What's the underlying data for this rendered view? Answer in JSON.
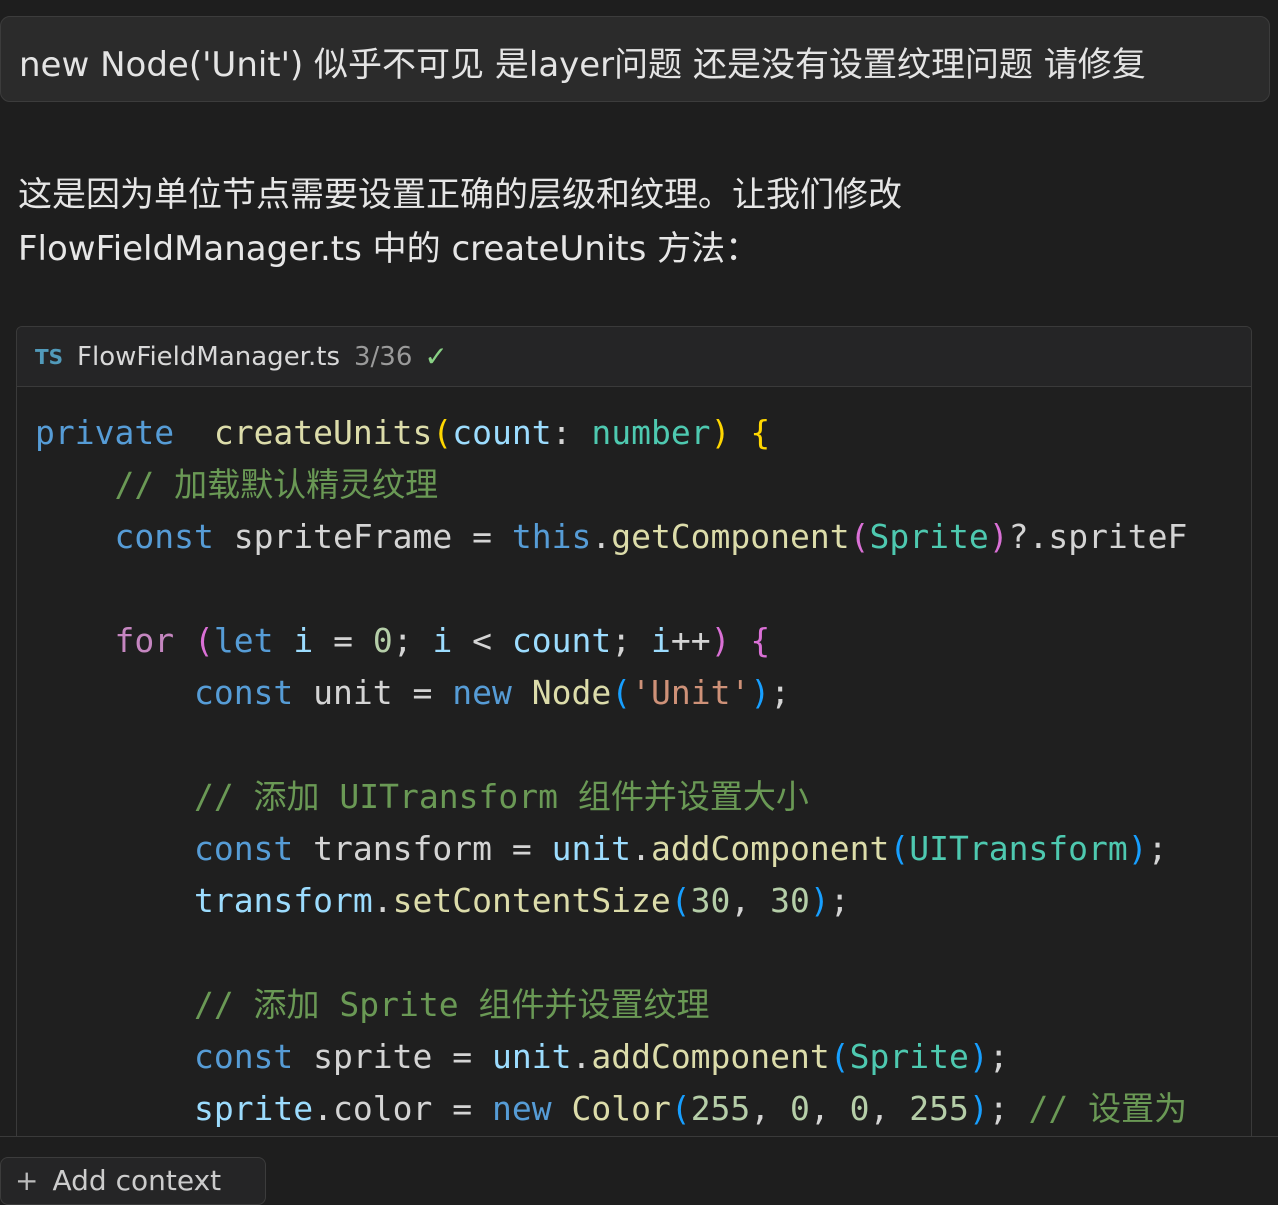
{
  "user_message": "new Node('Unit') 似乎不可见 是layer问题 还是没有设置纹理问题 请修复",
  "assistant": {
    "line1": "这是因为单位节点需要设置正确的层级和纹理。让我们修改",
    "line2": "FlowFieldManager.ts 中的 createUnits 方法："
  },
  "code_block": {
    "lang_icon": "TS",
    "filename": "FlowFieldManager.ts",
    "count": "3/36",
    "check_icon": "check-icon",
    "lines": [
      [
        [
          "kw",
          "private"
        ],
        [
          "",
          "  "
        ],
        [
          "fn",
          "createUnits"
        ],
        [
          "p1",
          "("
        ],
        [
          "var",
          "count"
        ],
        [
          "",
          ": "
        ],
        [
          "type",
          "number"
        ],
        [
          "p1",
          ")"
        ],
        [
          "",
          " "
        ],
        [
          "p1",
          "{"
        ]
      ],
      [
        [
          "",
          "    "
        ],
        [
          "cmt",
          "// 加载默认精灵纹理"
        ]
      ],
      [
        [
          "",
          "    "
        ],
        [
          "kw",
          "const"
        ],
        [
          "",
          " spriteFrame = "
        ],
        [
          "kw",
          "this"
        ],
        [
          "",
          "."
        ],
        [
          "fn",
          "getComponent"
        ],
        [
          "p2",
          "("
        ],
        [
          "type",
          "Sprite"
        ],
        [
          "p2",
          ")"
        ],
        [
          "",
          "?.spriteF"
        ]
      ],
      [
        [
          "",
          ""
        ]
      ],
      [
        [
          "",
          "    "
        ],
        [
          "ctl",
          "for"
        ],
        [
          "",
          " "
        ],
        [
          "p2",
          "("
        ],
        [
          "kw",
          "let"
        ],
        [
          "",
          " "
        ],
        [
          "var",
          "i"
        ],
        [
          "",
          " = "
        ],
        [
          "num",
          "0"
        ],
        [
          "",
          "; "
        ],
        [
          "var",
          "i"
        ],
        [
          "",
          " < "
        ],
        [
          "var",
          "count"
        ],
        [
          "",
          "; "
        ],
        [
          "var",
          "i"
        ],
        [
          "",
          "++"
        ],
        [
          "p2",
          ")"
        ],
        [
          "",
          " "
        ],
        [
          "p2",
          "{"
        ]
      ],
      [
        [
          "",
          "        "
        ],
        [
          "kw",
          "const"
        ],
        [
          "",
          " unit = "
        ],
        [
          "kw",
          "new"
        ],
        [
          "",
          " "
        ],
        [
          "fn",
          "Node"
        ],
        [
          "p3",
          "("
        ],
        [
          "str",
          "'Unit'"
        ],
        [
          "p3",
          ")"
        ],
        [
          "",
          ";"
        ]
      ],
      [
        [
          "",
          ""
        ]
      ],
      [
        [
          "",
          "        "
        ],
        [
          "cmt",
          "// 添加 UITransform 组件并设置大小"
        ]
      ],
      [
        [
          "",
          "        "
        ],
        [
          "kw",
          "const"
        ],
        [
          "",
          " transform = "
        ],
        [
          "var",
          "unit"
        ],
        [
          "",
          "."
        ],
        [
          "fn",
          "addComponent"
        ],
        [
          "p3",
          "("
        ],
        [
          "type",
          "UITransform"
        ],
        [
          "p3",
          ")"
        ],
        [
          "",
          ";"
        ]
      ],
      [
        [
          "",
          "        "
        ],
        [
          "var",
          "transform"
        ],
        [
          "",
          "."
        ],
        [
          "fn",
          "setContentSize"
        ],
        [
          "p3",
          "("
        ],
        [
          "num",
          "30"
        ],
        [
          "",
          ", "
        ],
        [
          "num",
          "30"
        ],
        [
          "p3",
          ")"
        ],
        [
          "",
          ";"
        ]
      ],
      [
        [
          "",
          ""
        ]
      ],
      [
        [
          "",
          "        "
        ],
        [
          "cmt",
          "// 添加 Sprite 组件并设置纹理"
        ]
      ],
      [
        [
          "",
          "        "
        ],
        [
          "kw",
          "const"
        ],
        [
          "",
          " sprite = "
        ],
        [
          "var",
          "unit"
        ],
        [
          "",
          "."
        ],
        [
          "fn",
          "addComponent"
        ],
        [
          "p3",
          "("
        ],
        [
          "type",
          "Sprite"
        ],
        [
          "p3",
          ")"
        ],
        [
          "",
          ";"
        ]
      ],
      [
        [
          "",
          "        "
        ],
        [
          "var",
          "sprite"
        ],
        [
          "",
          ".color = "
        ],
        [
          "kw",
          "new"
        ],
        [
          "",
          " "
        ],
        [
          "fn",
          "Color"
        ],
        [
          "p3",
          "("
        ],
        [
          "num",
          "255"
        ],
        [
          "",
          ", "
        ],
        [
          "num",
          "0"
        ],
        [
          "",
          ", "
        ],
        [
          "num",
          "0"
        ],
        [
          "",
          ", "
        ],
        [
          "num",
          "255"
        ],
        [
          "p3",
          ")"
        ],
        [
          "",
          "; "
        ],
        [
          "cmt",
          "// 设置为"
        ]
      ]
    ]
  },
  "footer": {
    "plus_icon": "+",
    "add_context_label": "Add context"
  }
}
